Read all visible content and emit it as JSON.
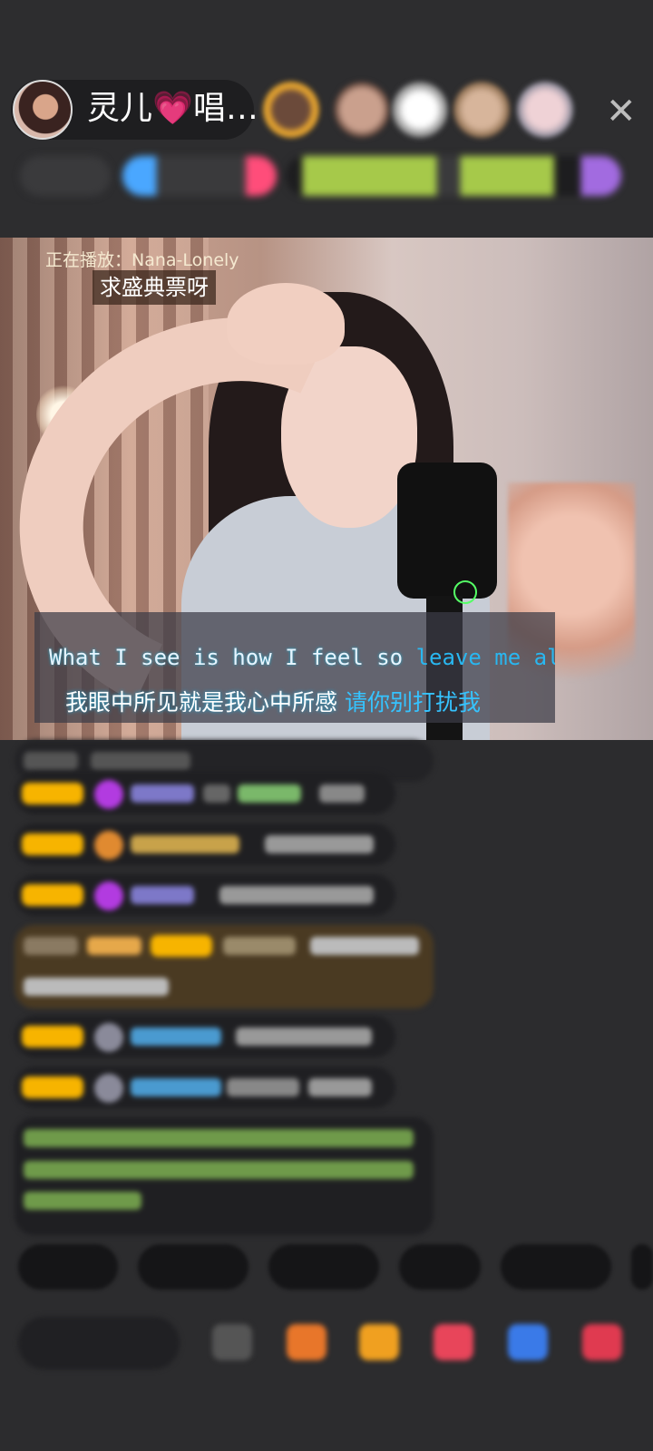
{
  "host": {
    "name": "灵儿",
    "name_heart": "💗",
    "name_suffix": "唱…"
  },
  "header": {
    "close_icon": "close-icon"
  },
  "stream": {
    "now_playing": "正在播放：Nana-Lonely",
    "request_text": "求盛典票呀",
    "lyrics_en_plain": "What I see is how I feel so ",
    "lyrics_en_highlight": "leave me alo",
    "lyrics_zh_plain": "我眼中所见就是我心中所感 ",
    "lyrics_zh_highlight": "请你别打扰我"
  },
  "colors": {
    "background": "#2c2c2e",
    "lyric_highlight": "#29b7f0",
    "badge": "#f7b400",
    "heart": "#ff5ab4"
  }
}
